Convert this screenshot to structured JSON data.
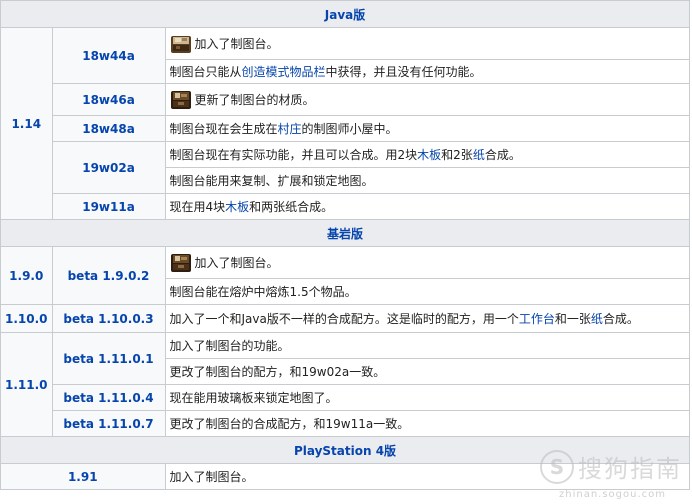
{
  "sections": {
    "java": "Java版",
    "bedrock": "基岩版",
    "ps4": "PlayStation 4版"
  },
  "java": {
    "major": "1.14",
    "r1": {
      "ver": "18w44a",
      "desc": "加入了制图台。"
    },
    "r2": {
      "pre": "制图台只能从",
      "link": "创造模式物品栏",
      "post": "中获得，并且没有任何功能。"
    },
    "r3": {
      "ver": "18w46a",
      "desc": "更新了制图台的材质。"
    },
    "r4": {
      "ver": "18w48a",
      "pre": "制图台现在会生成在",
      "link": "村庄",
      "post": "的制图师小屋中。"
    },
    "r5": {
      "ver": "19w02a",
      "pre": "制图台现在有实际功能，并且可以合成。用2块",
      "link1": "木板",
      "mid": "和2张",
      "link2": "纸",
      "post": "合成。"
    },
    "r6": {
      "desc": "制图台能用来复制、扩展和锁定地图。"
    },
    "r7": {
      "ver": "19w11a",
      "pre": "现在用4块",
      "link": "木板",
      "post": "和两张纸合成。"
    }
  },
  "bedrock": {
    "major1": "1.9.0",
    "r1": {
      "ver": "beta 1.9.0.2",
      "desc": "加入了制图台。"
    },
    "r2": {
      "desc": "制图台能在熔炉中熔炼1.5个物品。"
    },
    "major2": "1.10.0",
    "r3": {
      "ver": "beta 1.10.0.3",
      "pre": "加入了一个和Java版不一样的合成配方。这是临时的配方，用一个",
      "link1": "工作台",
      "mid": "和一张",
      "link2": "纸",
      "post": "合成。"
    },
    "major3": "1.11.0",
    "r4": {
      "ver": "beta 1.11.0.1",
      "desc": "加入了制图台的功能。"
    },
    "r5": {
      "desc": "更改了制图台的配方，和19w02a一致。"
    },
    "r6": {
      "ver": "beta 1.11.0.4",
      "desc": "现在能用玻璃板来锁定地图了。"
    },
    "r7": {
      "ver": "beta 1.11.0.7",
      "desc": "更改了制图台的合成配方，和19w11a一致。"
    }
  },
  "ps4": {
    "major": "1.91",
    "desc": "加入了制图台。"
  },
  "watermark": {
    "logo": "S",
    "text": "搜狗指南",
    "url": "zhinan.sogou.com"
  },
  "icons": [
    "cartography-table-icon-old",
    "cartography-table-icon-new"
  ]
}
